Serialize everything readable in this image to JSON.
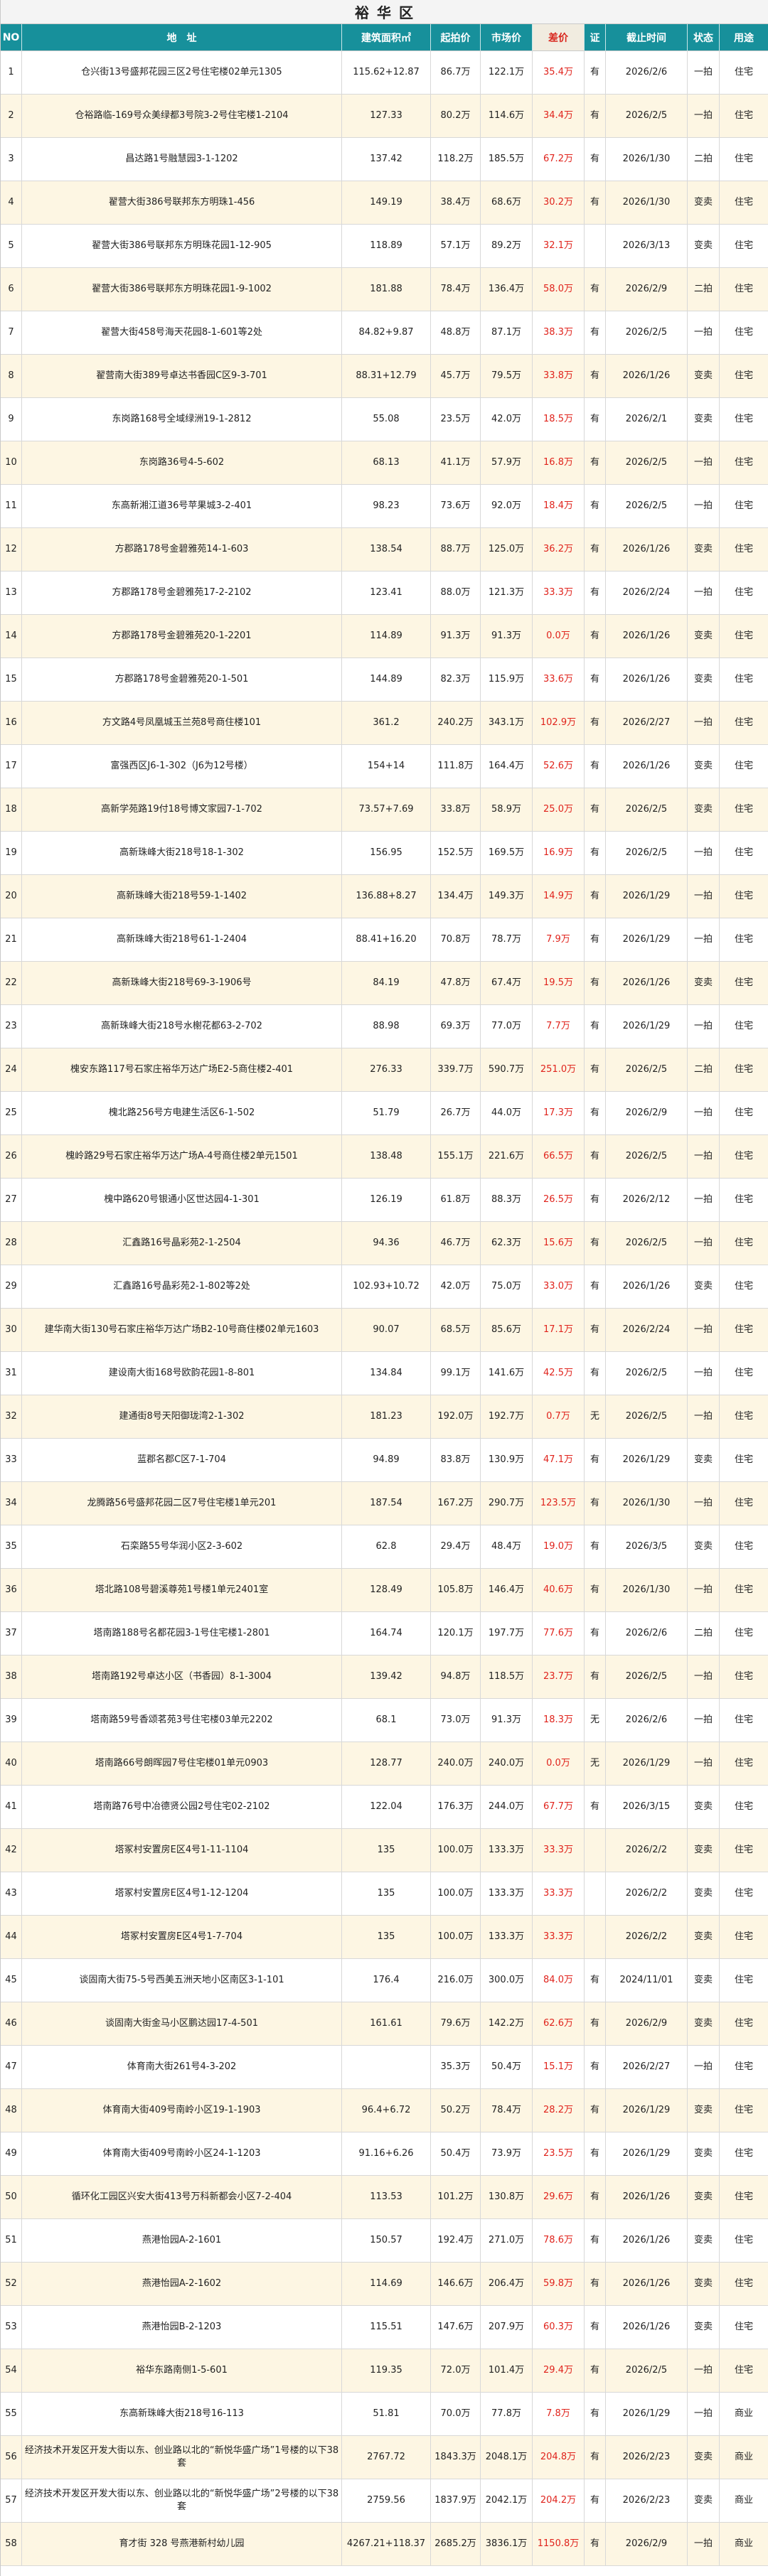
{
  "title": "裕 华 区",
  "headers": {
    "no": "NO",
    "address": "地　址",
    "area": "建筑面积㎡",
    "start_price": "起拍价",
    "market_price": "市场价",
    "diff": "差价",
    "cert": "证",
    "deadline": "截止时间",
    "status": "状态",
    "usage": "用途"
  },
  "colors": {
    "header_bg": "#17909b",
    "diff_text": "#e0231c",
    "stripe": "#fdf6e3"
  },
  "rows": [
    {
      "no": "1",
      "address": "仓兴街13号盛邦花园三区2号住宅楼02单元1305",
      "area": "115.62+12.87",
      "start": "86.7万",
      "market": "122.1万",
      "diff": "35.4万",
      "cert": "有",
      "deadline": "2026/2/6",
      "status": "一拍",
      "usage": "住宅"
    },
    {
      "no": "2",
      "address": "仓裕路临-169号众美绿都3号院3-2号住宅楼1-2104",
      "area": "127.33",
      "start": "80.2万",
      "market": "114.6万",
      "diff": "34.4万",
      "cert": "有",
      "deadline": "2026/2/5",
      "status": "一拍",
      "usage": "住宅"
    },
    {
      "no": "3",
      "address": "昌达路1号融慧园3-1-1202",
      "area": "137.42",
      "start": "118.2万",
      "market": "185.5万",
      "diff": "67.2万",
      "cert": "有",
      "deadline": "2026/1/30",
      "status": "二拍",
      "usage": "住宅"
    },
    {
      "no": "4",
      "address": "翟营大街386号联邦东方明珠1-456",
      "area": "149.19",
      "start": "38.4万",
      "market": "68.6万",
      "diff": "30.2万",
      "cert": "有",
      "deadline": "2026/1/30",
      "status": "变卖",
      "usage": "住宅"
    },
    {
      "no": "5",
      "address": "翟营大街386号联邦东方明珠花园1-12-905",
      "area": "118.89",
      "start": "57.1万",
      "market": "89.2万",
      "diff": "32.1万",
      "cert": "",
      "deadline": "2026/3/13",
      "status": "变卖",
      "usage": "住宅"
    },
    {
      "no": "6",
      "address": "翟营大街386号联邦东方明珠花园1-9-1002",
      "area": "181.88",
      "start": "78.4万",
      "market": "136.4万",
      "diff": "58.0万",
      "cert": "有",
      "deadline": "2026/2/9",
      "status": "二拍",
      "usage": "住宅"
    },
    {
      "no": "7",
      "address": "翟营大街458号海天花园8-1-601等2处",
      "area": "84.82+9.87",
      "start": "48.8万",
      "market": "87.1万",
      "diff": "38.3万",
      "cert": "有",
      "deadline": "2026/2/5",
      "status": "一拍",
      "usage": "住宅"
    },
    {
      "no": "8",
      "address": "翟营南大街389号卓达书香园C区9-3-701",
      "area": "88.31+12.79",
      "start": "45.7万",
      "market": "79.5万",
      "diff": "33.8万",
      "cert": "有",
      "deadline": "2026/1/26",
      "status": "变卖",
      "usage": "住宅"
    },
    {
      "no": "9",
      "address": "东岗路168号全域绿洲19-1-2812",
      "area": "55.08",
      "start": "23.5万",
      "market": "42.0万",
      "diff": "18.5万",
      "cert": "有",
      "deadline": "2026/2/1",
      "status": "变卖",
      "usage": "住宅"
    },
    {
      "no": "10",
      "address": "东岗路36号4-5-602",
      "area": "68.13",
      "start": "41.1万",
      "market": "57.9万",
      "diff": "16.8万",
      "cert": "有",
      "deadline": "2026/2/5",
      "status": "一拍",
      "usage": "住宅"
    },
    {
      "no": "11",
      "address": "东高新湘江道36号苹果城3-2-401",
      "area": "98.23",
      "start": "73.6万",
      "market": "92.0万",
      "diff": "18.4万",
      "cert": "有",
      "deadline": "2026/2/5",
      "status": "一拍",
      "usage": "住宅"
    },
    {
      "no": "12",
      "address": "方郡路178号金碧雅苑14-1-603",
      "area": "138.54",
      "start": "88.7万",
      "market": "125.0万",
      "diff": "36.2万",
      "cert": "有",
      "deadline": "2026/1/26",
      "status": "变卖",
      "usage": "住宅"
    },
    {
      "no": "13",
      "address": "方郡路178号金碧雅苑17-2-2102",
      "area": "123.41",
      "start": "88.0万",
      "market": "121.3万",
      "diff": "33.3万",
      "cert": "有",
      "deadline": "2026/2/24",
      "status": "一拍",
      "usage": "住宅"
    },
    {
      "no": "14",
      "address": "方郡路178号金碧雅苑20-1-2201",
      "area": "114.89",
      "start": "91.3万",
      "market": "91.3万",
      "diff": "0.0万",
      "cert": "有",
      "deadline": "2026/1/26",
      "status": "变卖",
      "usage": "住宅"
    },
    {
      "no": "15",
      "address": "方郡路178号金碧雅苑20-1-501",
      "area": "144.89",
      "start": "82.3万",
      "market": "115.9万",
      "diff": "33.6万",
      "cert": "有",
      "deadline": "2026/1/26",
      "status": "变卖",
      "usage": "住宅"
    },
    {
      "no": "16",
      "address": "方文路4号凤凰城玉兰苑8号商住楼101",
      "area": "361.2",
      "start": "240.2万",
      "market": "343.1万",
      "diff": "102.9万",
      "cert": "有",
      "deadline": "2026/2/27",
      "status": "一拍",
      "usage": "住宅"
    },
    {
      "no": "17",
      "address": "富强西区J6-1-302（J6为12号楼）",
      "area": "154+14",
      "start": "111.8万",
      "market": "164.4万",
      "diff": "52.6万",
      "cert": "有",
      "deadline": "2026/1/26",
      "status": "变卖",
      "usage": "住宅"
    },
    {
      "no": "18",
      "address": "高新学苑路19付18号博文家园7-1-702",
      "area": "73.57+7.69",
      "start": "33.8万",
      "market": "58.9万",
      "diff": "25.0万",
      "cert": "有",
      "deadline": "2026/2/5",
      "status": "变卖",
      "usage": "住宅"
    },
    {
      "no": "19",
      "address": "高新珠峰大街218号18-1-302",
      "area": "156.95",
      "start": "152.5万",
      "market": "169.5万",
      "diff": "16.9万",
      "cert": "有",
      "deadline": "2026/2/5",
      "status": "一拍",
      "usage": "住宅"
    },
    {
      "no": "20",
      "address": "高新珠峰大街218号59-1-1402",
      "area": "136.88+8.27",
      "start": "134.4万",
      "market": "149.3万",
      "diff": "14.9万",
      "cert": "有",
      "deadline": "2026/1/29",
      "status": "一拍",
      "usage": "住宅"
    },
    {
      "no": "21",
      "address": "高新珠峰大街218号61-1-2404",
      "area": "88.41+16.20",
      "start": "70.8万",
      "market": "78.7万",
      "diff": "7.9万",
      "cert": "有",
      "deadline": "2026/1/29",
      "status": "一拍",
      "usage": "住宅"
    },
    {
      "no": "22",
      "address": "高新珠峰大街218号69-3-1906号",
      "area": "84.19",
      "start": "47.8万",
      "market": "67.4万",
      "diff": "19.5万",
      "cert": "有",
      "deadline": "2026/1/26",
      "status": "变卖",
      "usage": "住宅"
    },
    {
      "no": "23",
      "address": "高新珠峰大街218号水榭花都63-2-702",
      "area": "88.98",
      "start": "69.3万",
      "market": "77.0万",
      "diff": "7.7万",
      "cert": "有",
      "deadline": "2026/1/29",
      "status": "一拍",
      "usage": "住宅"
    },
    {
      "no": "24",
      "address": "槐安东路117号石家庄裕华万达广场E2-5商住楼2-401",
      "area": "276.33",
      "start": "339.7万",
      "market": "590.7万",
      "diff": "251.0万",
      "cert": "有",
      "deadline": "2026/2/5",
      "status": "二拍",
      "usage": "住宅"
    },
    {
      "no": "25",
      "address": "槐北路256号方电建生活区6-1-502",
      "area": "51.79",
      "start": "26.7万",
      "market": "44.0万",
      "diff": "17.3万",
      "cert": "有",
      "deadline": "2026/2/9",
      "status": "一拍",
      "usage": "住宅"
    },
    {
      "no": "26",
      "address": "槐岭路29号石家庄裕华万达广场A-4号商住楼2单元1501",
      "area": "138.48",
      "start": "155.1万",
      "market": "221.6万",
      "diff": "66.5万",
      "cert": "有",
      "deadline": "2026/2/5",
      "status": "一拍",
      "usage": "住宅"
    },
    {
      "no": "27",
      "address": "槐中路620号银通小区世达园4-1-301",
      "area": "126.19",
      "start": "61.8万",
      "market": "88.3万",
      "diff": "26.5万",
      "cert": "有",
      "deadline": "2026/2/12",
      "status": "一拍",
      "usage": "住宅"
    },
    {
      "no": "28",
      "address": "汇鑫路16号晶彩苑2-1-2504",
      "area": "94.36",
      "start": "46.7万",
      "market": "62.3万",
      "diff": "15.6万",
      "cert": "有",
      "deadline": "2026/2/5",
      "status": "一拍",
      "usage": "住宅"
    },
    {
      "no": "29",
      "address": "汇鑫路16号晶彩苑2-1-802等2处",
      "area": "102.93+10.72",
      "start": "42.0万",
      "market": "75.0万",
      "diff": "33.0万",
      "cert": "有",
      "deadline": "2026/1/26",
      "status": "变卖",
      "usage": "住宅"
    },
    {
      "no": "30",
      "address": "建华南大街130号石家庄裕华万达广场B2-10号商住楼02单元1603",
      "area": "90.07",
      "start": "68.5万",
      "market": "85.6万",
      "diff": "17.1万",
      "cert": "有",
      "deadline": "2026/2/24",
      "status": "一拍",
      "usage": "住宅"
    },
    {
      "no": "31",
      "address": "建设南大街168号欧韵花园1-8-801",
      "area": "134.84",
      "start": "99.1万",
      "market": "141.6万",
      "diff": "42.5万",
      "cert": "有",
      "deadline": "2026/2/5",
      "status": "一拍",
      "usage": "住宅"
    },
    {
      "no": "32",
      "address": "建通街8号天阳御珑湾2-1-302",
      "area": "181.23",
      "start": "192.0万",
      "market": "192.7万",
      "diff": "0.7万",
      "cert": "无",
      "deadline": "2026/2/5",
      "status": "一拍",
      "usage": "住宅"
    },
    {
      "no": "33",
      "address": "蓝郡名郡C区7-1-704",
      "area": "94.89",
      "start": "83.8万",
      "market": "130.9万",
      "diff": "47.1万",
      "cert": "有",
      "deadline": "2026/1/29",
      "status": "变卖",
      "usage": "住宅"
    },
    {
      "no": "34",
      "address": "龙腾路56号盛邦花园二区7号住宅楼1单元201",
      "area": "187.54",
      "start": "167.2万",
      "market": "290.7万",
      "diff": "123.5万",
      "cert": "有",
      "deadline": "2026/1/30",
      "status": "一拍",
      "usage": "住宅"
    },
    {
      "no": "35",
      "address": "石栾路55号华润小区2-3-602",
      "area": "62.8",
      "start": "29.4万",
      "market": "48.4万",
      "diff": "19.0万",
      "cert": "有",
      "deadline": "2026/3/5",
      "status": "变卖",
      "usage": "住宅"
    },
    {
      "no": "36",
      "address": "塔北路108号碧溪尊苑1号楼1单元2401室",
      "area": "128.49",
      "start": "105.8万",
      "market": "146.4万",
      "diff": "40.6万",
      "cert": "有",
      "deadline": "2026/1/30",
      "status": "一拍",
      "usage": "住宅"
    },
    {
      "no": "37",
      "address": "塔南路188号名都花园3-1号住宅楼1-2801",
      "area": "164.74",
      "start": "120.1万",
      "market": "197.7万",
      "diff": "77.6万",
      "cert": "有",
      "deadline": "2026/2/6",
      "status": "二拍",
      "usage": "住宅"
    },
    {
      "no": "38",
      "address": "塔南路192号卓达小区（书香园）8-1-3004",
      "area": "139.42",
      "start": "94.8万",
      "market": "118.5万",
      "diff": "23.7万",
      "cert": "有",
      "deadline": "2026/2/5",
      "status": "一拍",
      "usage": "住宅"
    },
    {
      "no": "39",
      "address": "塔南路59号香颂茗苑3号住宅楼03单元2202",
      "area": "68.1",
      "start": "73.0万",
      "market": "91.3万",
      "diff": "18.3万",
      "cert": "无",
      "deadline": "2026/2/6",
      "status": "一拍",
      "usage": "住宅"
    },
    {
      "no": "40",
      "address": "塔南路66号朗晖园7号住宅楼01单元0903",
      "area": "128.77",
      "start": "240.0万",
      "market": "240.0万",
      "diff": "0.0万",
      "cert": "无",
      "deadline": "2026/1/29",
      "status": "一拍",
      "usage": "住宅"
    },
    {
      "no": "41",
      "address": "塔南路76号中冶德贤公园2号住宅02-2102",
      "area": "122.04",
      "start": "176.3万",
      "market": "244.0万",
      "diff": "67.7万",
      "cert": "有",
      "deadline": "2026/3/15",
      "status": "变卖",
      "usage": "住宅"
    },
    {
      "no": "42",
      "address": "塔冢村安置房E区4号1-11-1104",
      "area": "135",
      "start": "100.0万",
      "market": "133.3万",
      "diff": "33.3万",
      "cert": "",
      "deadline": "2026/2/2",
      "status": "变卖",
      "usage": "住宅"
    },
    {
      "no": "43",
      "address": "塔冢村安置房E区4号1-12-1204",
      "area": "135",
      "start": "100.0万",
      "market": "133.3万",
      "diff": "33.3万",
      "cert": "",
      "deadline": "2026/2/2",
      "status": "变卖",
      "usage": "住宅"
    },
    {
      "no": "44",
      "address": "塔冢村安置房E区4号1-7-704",
      "area": "135",
      "start": "100.0万",
      "market": "133.3万",
      "diff": "33.3万",
      "cert": "",
      "deadline": "2026/2/2",
      "status": "变卖",
      "usage": "住宅"
    },
    {
      "no": "45",
      "address": "谈固南大街75-5号西美五洲天地小区南区3-1-101",
      "area": "176.4",
      "start": "216.0万",
      "market": "300.0万",
      "diff": "84.0万",
      "cert": "有",
      "deadline": "2024/11/01",
      "status": "变卖",
      "usage": "住宅"
    },
    {
      "no": "46",
      "address": "谈固南大街金马小区鹏达园17-4-501",
      "area": "161.61",
      "start": "79.6万",
      "market": "142.2万",
      "diff": "62.6万",
      "cert": "有",
      "deadline": "2026/2/9",
      "status": "变卖",
      "usage": "住宅"
    },
    {
      "no": "47",
      "address": "体育南大街261号4-3-202",
      "area": "",
      "start": "35.3万",
      "market": "50.4万",
      "diff": "15.1万",
      "cert": "有",
      "deadline": "2026/2/27",
      "status": "一拍",
      "usage": "住宅"
    },
    {
      "no": "48",
      "address": "体育南大街409号南岭小区19-1-1903",
      "area": "96.4+6.72",
      "start": "50.2万",
      "market": "78.4万",
      "diff": "28.2万",
      "cert": "有",
      "deadline": "2026/1/29",
      "status": "变卖",
      "usage": "住宅"
    },
    {
      "no": "49",
      "address": "体育南大街409号南岭小区24-1-1203",
      "area": "91.16+6.26",
      "start": "50.4万",
      "market": "73.9万",
      "diff": "23.5万",
      "cert": "有",
      "deadline": "2026/1/29",
      "status": "变卖",
      "usage": "住宅"
    },
    {
      "no": "50",
      "address": "循环化工园区兴安大街413号万科新都会小区7-2-404",
      "area": "113.53",
      "start": "101.2万",
      "market": "130.8万",
      "diff": "29.6万",
      "cert": "有",
      "deadline": "2026/1/26",
      "status": "变卖",
      "usage": "住宅"
    },
    {
      "no": "51",
      "address": "燕港怡园A-2-1601",
      "area": "150.57",
      "start": "192.4万",
      "market": "271.0万",
      "diff": "78.6万",
      "cert": "有",
      "deadline": "2026/1/26",
      "status": "变卖",
      "usage": "住宅"
    },
    {
      "no": "52",
      "address": "燕港怡园A-2-1602",
      "area": "114.69",
      "start": "146.6万",
      "market": "206.4万",
      "diff": "59.8万",
      "cert": "有",
      "deadline": "2026/1/26",
      "status": "变卖",
      "usage": "住宅"
    },
    {
      "no": "53",
      "address": "燕港怡园B-2-1203",
      "area": "115.51",
      "start": "147.6万",
      "market": "207.9万",
      "diff": "60.3万",
      "cert": "有",
      "deadline": "2026/1/26",
      "status": "变卖",
      "usage": "住宅"
    },
    {
      "no": "54",
      "address": "裕华东路南侧1-5-601",
      "area": "119.35",
      "start": "72.0万",
      "market": "101.4万",
      "diff": "29.4万",
      "cert": "有",
      "deadline": "2026/2/5",
      "status": "一拍",
      "usage": "住宅"
    },
    {
      "no": "55",
      "address": "东高新珠峰大街218号16-113",
      "area": "51.81",
      "start": "70.0万",
      "market": "77.8万",
      "diff": "7.8万",
      "cert": "有",
      "deadline": "2026/1/29",
      "status": "一拍",
      "usage": "商业"
    },
    {
      "no": "56",
      "address": "经济技术开发区开发大街以东、创业路以北的“新悦华盛广场”1号楼的以下38套",
      "area": "2767.72",
      "start": "1843.3万",
      "market": "2048.1万",
      "diff": "204.8万",
      "cert": "有",
      "deadline": "2026/2/23",
      "status": "变卖",
      "usage": "商业"
    },
    {
      "no": "57",
      "address": "经济技术开发区开发大街以东、创业路以北的“新悦华盛广场”2号楼的以下38套",
      "area": "2759.56",
      "start": "1837.9万",
      "market": "2042.1万",
      "diff": "204.2万",
      "cert": "有",
      "deadline": "2026/2/23",
      "status": "变卖",
      "usage": "商业"
    },
    {
      "no": "58",
      "address": "育才街 328 号燕港新村幼儿园",
      "area": "4267.21+118.37",
      "start": "2685.2万",
      "market": "3836.1万",
      "diff": "1150.8万",
      "cert": "有",
      "deadline": "2026/2/9",
      "status": "一拍",
      "usage": "商业"
    }
  ]
}
